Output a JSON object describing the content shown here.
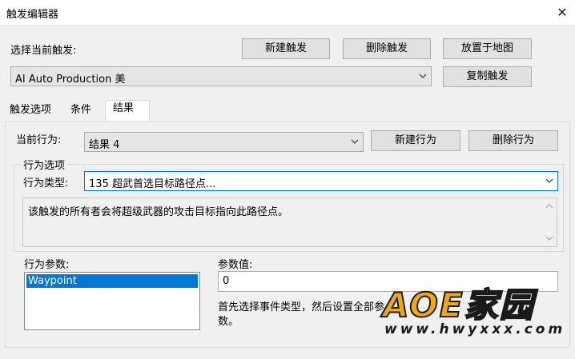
{
  "window": {
    "title": "触发编辑器",
    "close_glyph": "✕"
  },
  "select_trigger": {
    "label": "选择当前触发:",
    "value": "AI Auto Production 美"
  },
  "buttons": {
    "new_trigger": "新建触发",
    "delete_trigger": "删除触发",
    "place_on_map": "放置于地图",
    "copy_trigger": "复制触发"
  },
  "tabs": [
    {
      "label": "触发选项",
      "active": false
    },
    {
      "label": "条件",
      "active": false
    },
    {
      "label": "结果",
      "active": true
    }
  ],
  "results": {
    "current_action_label": "当前行为:",
    "current_action_value": "结果 4",
    "new_action": "新建行为",
    "delete_action": "删除行为"
  },
  "action_options": {
    "group_title": "行为选项",
    "type_label": "行为类型:",
    "type_value": "135 超武首选目标路径点...",
    "description": "该触发的所有者会将超级武器的攻击目标指向此路径点。"
  },
  "params": {
    "label": "行为参数:",
    "items": [
      "Waypoint"
    ],
    "value_label": "参数值:",
    "value": "0",
    "hint": "首先选择事件类型，然后设置全部参数。"
  },
  "watermark": {
    "main": "AOE家园",
    "sub": "www.hwyxxx.com"
  },
  "colors": {
    "selection": "#0078d7",
    "watermark": "#f2a900"
  }
}
